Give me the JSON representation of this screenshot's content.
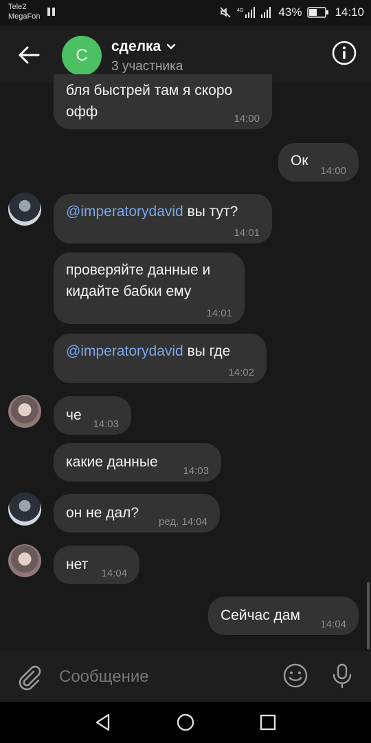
{
  "status": {
    "carrier1": "Tele2",
    "carrier2": "MegaFon",
    "battery": "43%",
    "time": "14:10"
  },
  "header": {
    "avatar_letter": "С",
    "title": "сделка",
    "subtitle": "3 участника"
  },
  "messages": [
    {
      "text": "бля быстрей там я скоро",
      "text2": "офф",
      "time": "14:00"
    },
    {
      "text": "Ок",
      "time": "14:00"
    },
    {
      "mention": "@imperatorydavid",
      "text": " вы тут?",
      "time": "14:01"
    },
    {
      "text": "проверяйте данные и",
      "text2": "кидайте бабки ему",
      "time": "14:01"
    },
    {
      "mention": "@imperatorydavid",
      "text": " вы где",
      "time": "14:02"
    },
    {
      "text": "че",
      "time": "14:03"
    },
    {
      "text": "какие данные",
      "time": "14:03"
    },
    {
      "text": "он не дал?",
      "time": "ред. 14:04"
    },
    {
      "text": "нет",
      "time": "14:04"
    },
    {
      "text": "Сейчас дам",
      "time": "14:04"
    }
  ],
  "composer": {
    "placeholder": "Сообщение"
  },
  "colors": {
    "background": "#191919",
    "bubble": "#333333",
    "mention": "#7aa6e6",
    "group_avatar": "#4bc163"
  }
}
